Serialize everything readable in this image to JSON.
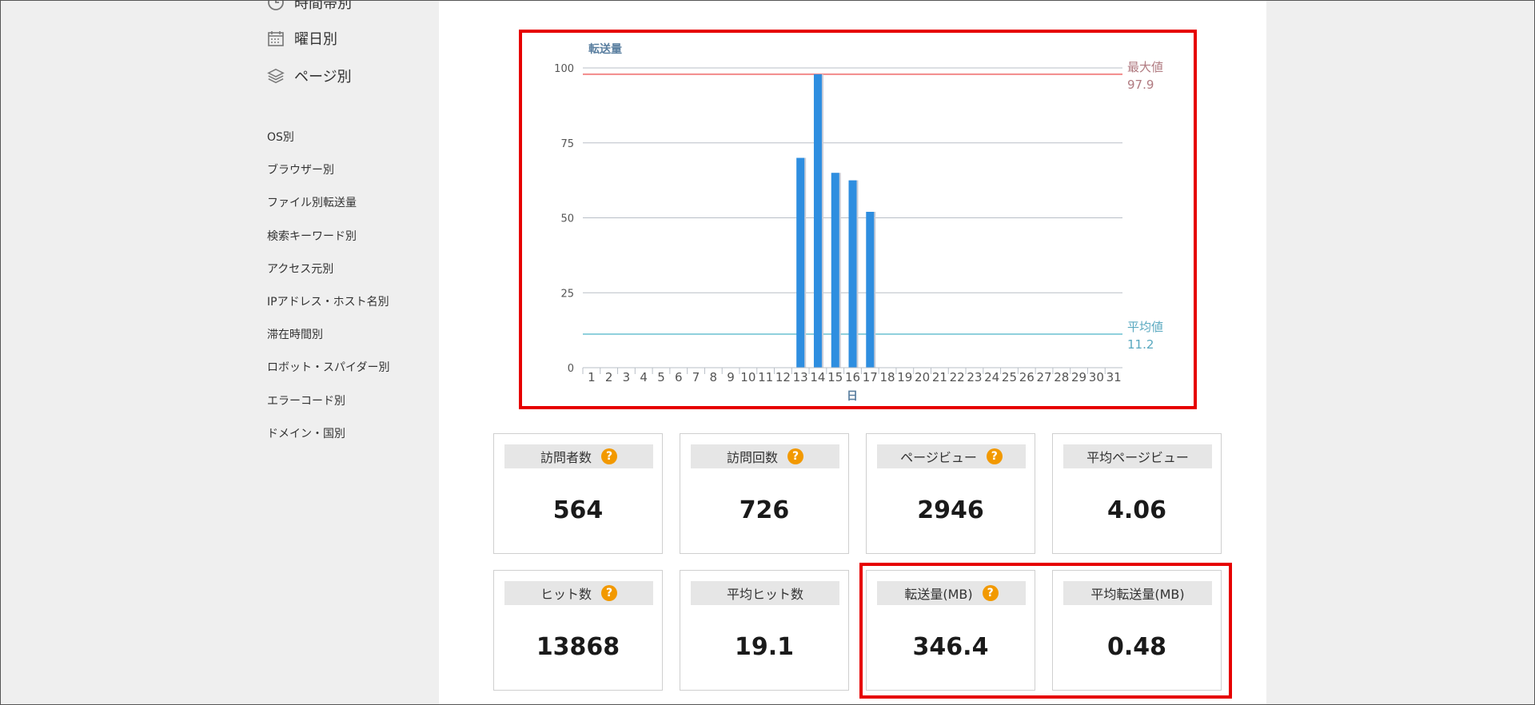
{
  "sidebar": {
    "top_items": [
      {
        "label": "時間帯別",
        "icon": "clock-icon"
      },
      {
        "label": "曜日別",
        "icon": "calendar-icon"
      },
      {
        "label": "ページ別",
        "icon": "layers-icon"
      }
    ],
    "items": [
      {
        "label": "OS別"
      },
      {
        "label": "ブラウザー別"
      },
      {
        "label": "ファイル別転送量"
      },
      {
        "label": "検索キーワード別"
      },
      {
        "label": "アクセス元別"
      },
      {
        "label": "IPアドレス・ホスト名別"
      },
      {
        "label": "滞在時間別"
      },
      {
        "label": "ロボット・スパイダー別"
      },
      {
        "label": "エラーコード別"
      },
      {
        "label": "ドメイン・国別"
      }
    ]
  },
  "chart_data": {
    "type": "bar",
    "title": "",
    "ylabel": "転送量",
    "xlabel": "日",
    "ylim": [
      0,
      100
    ],
    "yticks": [
      "0",
      "25",
      "50",
      "75",
      "100"
    ],
    "categories": [
      "1",
      "2",
      "3",
      "4",
      "5",
      "6",
      "7",
      "8",
      "9",
      "10",
      "11",
      "12",
      "13",
      "14",
      "15",
      "16",
      "17",
      "18",
      "19",
      "20",
      "21",
      "22",
      "23",
      "24",
      "25",
      "26",
      "27",
      "28",
      "29",
      "30",
      "31"
    ],
    "values": [
      0,
      0,
      0,
      0,
      0,
      0,
      0,
      0,
      0,
      0,
      0,
      0,
      70,
      97.9,
      65,
      62.5,
      52,
      0,
      0,
      0,
      0,
      0,
      0,
      0,
      0,
      0,
      0,
      0,
      0,
      0,
      0
    ],
    "reference_lines": [
      {
        "label": "最大値",
        "value_text": "97.9",
        "value": 97.9,
        "color": "#f28a8a"
      },
      {
        "label": "平均値",
        "value_text": "11.2",
        "value": 11.2,
        "color": "#8fd0dc"
      }
    ],
    "bar_color": "#2e8ee0",
    "grid": true
  },
  "cards": [
    {
      "label": "訪問者数",
      "value": "564",
      "help": "?"
    },
    {
      "label": "訪問回数",
      "value": "726",
      "help": "?"
    },
    {
      "label": "ページビュー",
      "value": "2946",
      "help": "?"
    },
    {
      "label": "平均ページビュー",
      "value": "4.06",
      "help": ""
    },
    {
      "label": "ヒット数",
      "value": "13868",
      "help": "?"
    },
    {
      "label": "平均ヒット数",
      "value": "19.1",
      "help": ""
    },
    {
      "label": "転送量(MB)",
      "value": "346.4",
      "help": "?"
    },
    {
      "label": "平均転送量(MB)",
      "value": "0.48",
      "help": ""
    }
  ]
}
